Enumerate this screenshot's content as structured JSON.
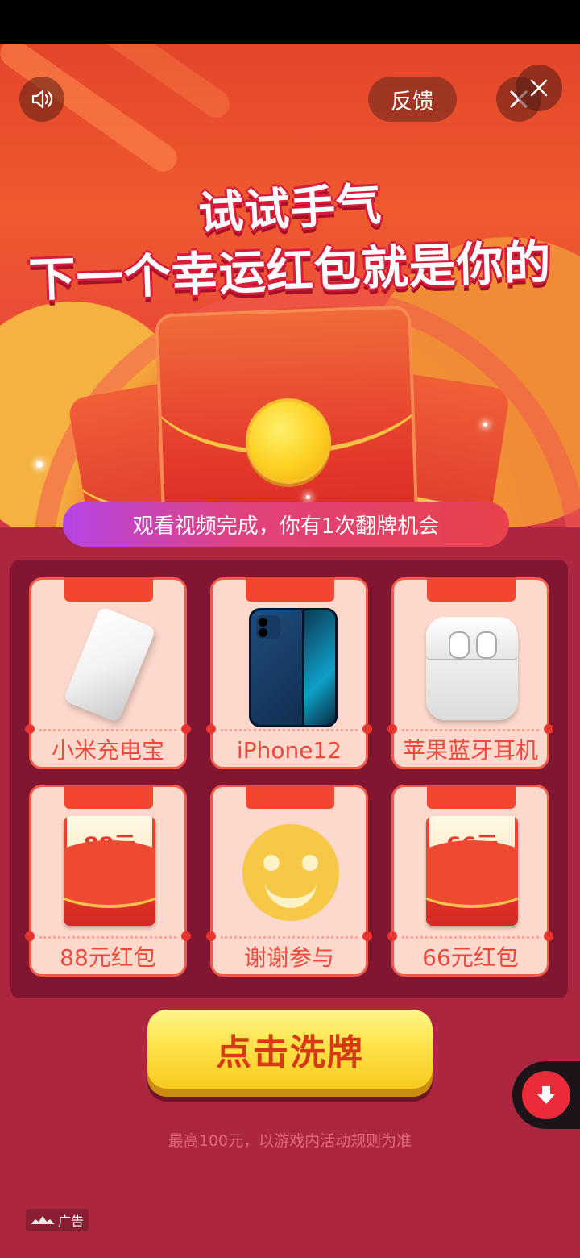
{
  "top_bar": {
    "feedback_label": "反馈",
    "sound_icon": "speaker-icon",
    "close_icon": "close-icon"
  },
  "hero": {
    "headline_line1": "试试手气",
    "headline_line2": "下一个幸运红包就是你的"
  },
  "status_pill": "观看视频完成，你有1次翻牌机会",
  "prizes": [
    {
      "label": "小米充电宝",
      "icon": "power-bank-icon"
    },
    {
      "label": "iPhone12",
      "icon": "iphone-icon"
    },
    {
      "label": "苹果蓝牙耳机",
      "icon": "airpods-icon"
    },
    {
      "label": "88元红包",
      "icon": "red-envelope-icon",
      "envelope_text": "88元"
    },
    {
      "label": "谢谢参与",
      "icon": "smiley-icon"
    },
    {
      "label": "66元红包",
      "icon": "red-envelope-icon",
      "envelope_text": "66元"
    }
  ],
  "cta_label": "点击洗牌",
  "rules_text": "最高100元，以游戏内活动规则为准",
  "ad_label": "广告",
  "download_icon": "download-arrow-icon",
  "colors": {
    "background": "#ad2640",
    "panel": "#821530",
    "card": "#fdd8cc",
    "accent_red": "#f4452f",
    "cta_yellow": "#fde34a",
    "cta_text": "#d43a13"
  }
}
